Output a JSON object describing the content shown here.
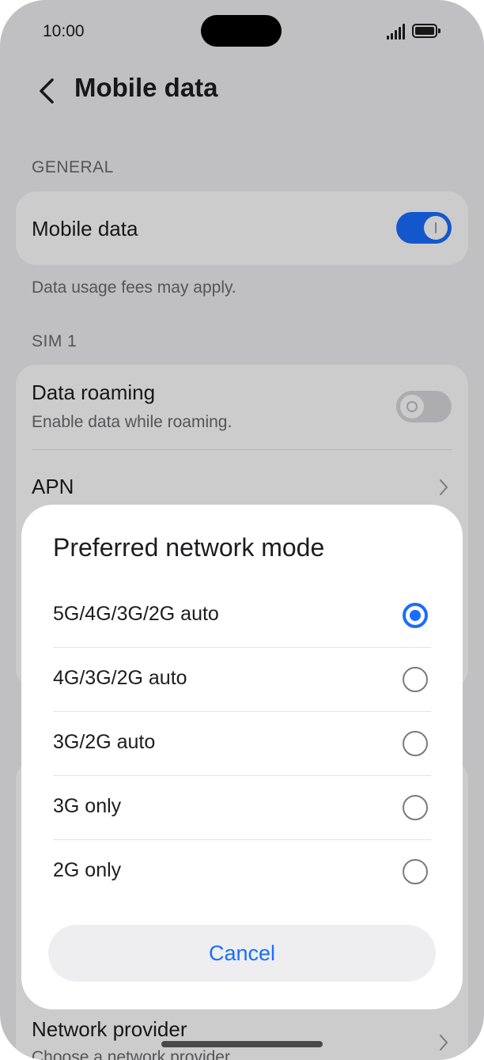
{
  "status_bar": {
    "time": "10:00"
  },
  "header": {
    "title": "Mobile data"
  },
  "general": {
    "section_label": "GENERAL",
    "mobile_data": {
      "label": "Mobile data",
      "enabled": true
    },
    "note": "Data usage fees may apply."
  },
  "sim1": {
    "section_label": "SIM 1",
    "data_roaming": {
      "label": "Data roaming",
      "subtitle": "Enable data while roaming.",
      "enabled": false
    },
    "apn": {
      "label": "APN"
    }
  },
  "network_provider": {
    "label": "Network provider",
    "subtitle": "Choose a network provider"
  },
  "dialog": {
    "title": "Preferred network mode",
    "options": [
      {
        "label": "5G/4G/3G/2G auto",
        "selected": true
      },
      {
        "label": "4G/3G/2G auto",
        "selected": false
      },
      {
        "label": "3G/2G auto",
        "selected": false
      },
      {
        "label": "3G only",
        "selected": false
      },
      {
        "label": "2G only",
        "selected": false
      }
    ],
    "cancel_label": "Cancel"
  },
  "colors": {
    "accent": "#1a6dff",
    "background": "#f1f1f3",
    "scrim": "rgba(0,0,0,0.2)"
  }
}
